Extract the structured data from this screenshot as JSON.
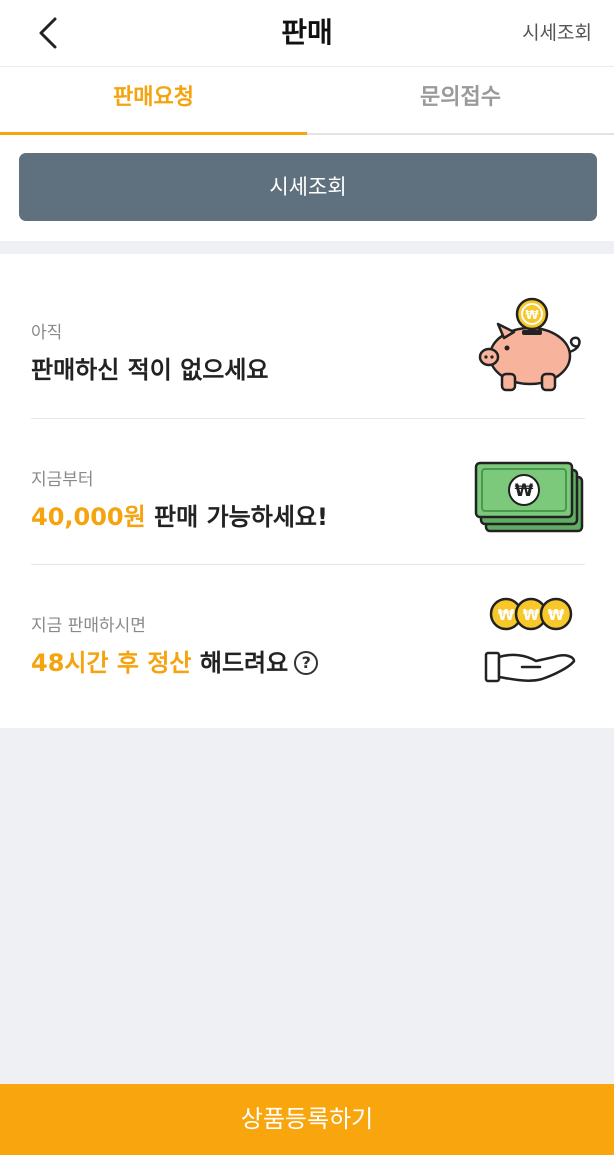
{
  "header": {
    "title": "판매",
    "right_link": "시세조회",
    "back_icon": "chevron-left-icon"
  },
  "tabs": [
    {
      "label": "판매요청",
      "active": true
    },
    {
      "label": "문의접수",
      "active": false
    }
  ],
  "quote_button": {
    "label": "시세조회"
  },
  "info_rows": [
    {
      "label": "아직",
      "main_text": "판매하신 적이 없으세요",
      "icon": "piggy-bank-icon"
    },
    {
      "label": "지금부터",
      "highlight": "40,000원",
      "main_suffix": " 판매 가능하세요!",
      "icon": "cash-stack-icon"
    },
    {
      "label": "지금 판매하시면",
      "highlight": "48시간 후 정산",
      "main_suffix": " 해드려요",
      "help_glyph": "?",
      "icon": "coins-hand-icon"
    }
  ],
  "footer": {
    "button_label": "상품등록하기"
  },
  "colors": {
    "accent": "#f5a30f",
    "button_primary": "#5f717e",
    "footer_button": "#f9a50e",
    "background": "#eff0f4"
  }
}
